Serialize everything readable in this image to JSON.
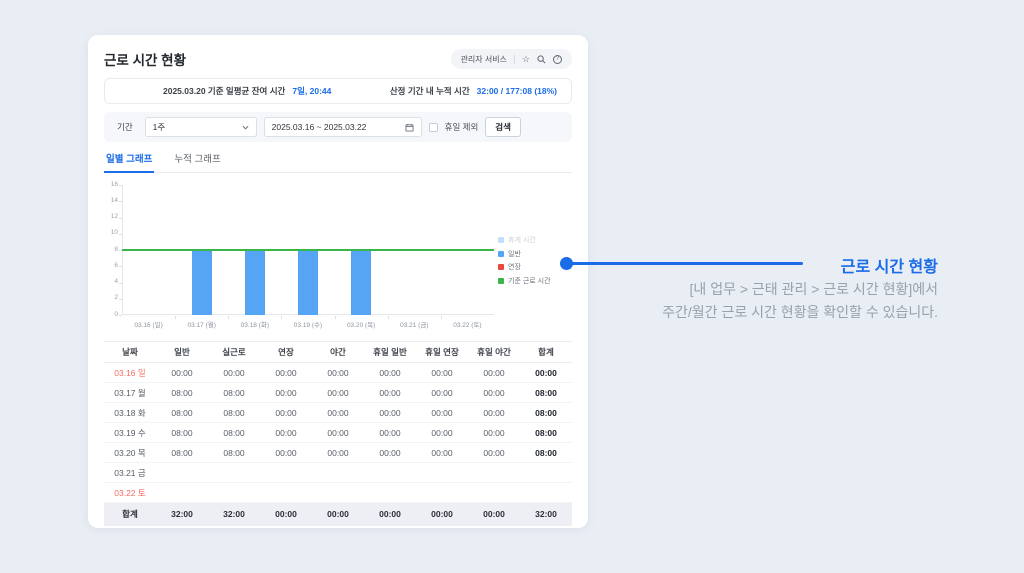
{
  "header": {
    "title": "근로 시간 현황",
    "admin_service_label": "관리자 서비스",
    "star_icon": "☆",
    "help_icon": "?"
  },
  "summary": {
    "left_label": "2025.03.20 기준 일평균 잔여 시간",
    "left_value": "7일, 20:44",
    "right_label": "산정 기간 내 누적 시간",
    "right_value": "32:00 / 177:08 (18%)"
  },
  "filter": {
    "period_label": "기간",
    "period_value": "1주",
    "date_range": "2025.03.16 ~ 2025.03.22",
    "holiday_checkbox_label": "휴일 제외",
    "holiday_checkbox_checked": false,
    "search_button_label": "검색"
  },
  "tabs": [
    {
      "label": "일별 그래프",
      "active": true
    },
    {
      "label": "누적 그래프",
      "active": false
    }
  ],
  "chart_data": {
    "type": "bar",
    "categories": [
      "03.16 (일)",
      "03.17 (월)",
      "03.18 (화)",
      "03.19 (수)",
      "03.20 (목)",
      "03.21 (금)",
      "03.22 (토)"
    ],
    "series": [
      {
        "name": "일반",
        "color": "#55a5f4",
        "values": [
          0,
          8,
          8,
          8,
          8,
          0,
          0
        ]
      },
      {
        "name": "연장",
        "color": "#e9493d",
        "values": [
          0,
          0,
          0,
          0,
          0,
          0,
          0
        ]
      }
    ],
    "reference_line": {
      "name": "기준 근로 시간",
      "value": 8,
      "color": "#3ab54a"
    },
    "legend": [
      {
        "label": "휴게 시간",
        "color": "#55a5f4",
        "muted": true
      },
      {
        "label": "일반",
        "color": "#55a5f4",
        "muted": false
      },
      {
        "label": "연장",
        "color": "#e9493d",
        "muted": false
      },
      {
        "label": "기준 근로 시간",
        "color": "#3ab54a",
        "muted": false
      }
    ],
    "title": "",
    "xlabel": "",
    "ylabel": "",
    "ylim": [
      0,
      16
    ],
    "ytick_step": 2,
    "grid": false,
    "legend_position": "right"
  },
  "table": {
    "headers": [
      "날짜",
      "일반",
      "실근로",
      "연장",
      "야간",
      "휴일 일반",
      "휴일 연장",
      "휴일 야간",
      "합계"
    ],
    "rows": [
      {
        "date": "03.16 일",
        "holiday": true,
        "values": [
          "00:00",
          "00:00",
          "00:00",
          "00:00",
          "00:00",
          "00:00",
          "00:00"
        ],
        "total": "00:00"
      },
      {
        "date": "03.17 월",
        "holiday": false,
        "values": [
          "08:00",
          "08:00",
          "00:00",
          "00:00",
          "00:00",
          "00:00",
          "00:00"
        ],
        "total": "08:00"
      },
      {
        "date": "03.18 화",
        "holiday": false,
        "values": [
          "08:00",
          "08:00",
          "00:00",
          "00:00",
          "00:00",
          "00:00",
          "00:00"
        ],
        "total": "08:00"
      },
      {
        "date": "03.19 수",
        "holiday": false,
        "values": [
          "08:00",
          "08:00",
          "00:00",
          "00:00",
          "00:00",
          "00:00",
          "00:00"
        ],
        "total": "08:00"
      },
      {
        "date": "03.20 목",
        "holiday": false,
        "values": [
          "08:00",
          "08:00",
          "00:00",
          "00:00",
          "00:00",
          "00:00",
          "00:00"
        ],
        "total": "08:00"
      },
      {
        "date": "03.21 금",
        "holiday": false,
        "values": [
          "",
          "",
          "",
          "",
          "",
          "",
          ""
        ],
        "total": ""
      },
      {
        "date": "03.22 토",
        "holiday": true,
        "values": [
          "",
          "",
          "",
          "",
          "",
          "",
          ""
        ],
        "total": ""
      }
    ],
    "footer": {
      "label": "합계",
      "values": [
        "32:00",
        "32:00",
        "00:00",
        "00:00",
        "00:00",
        "00:00",
        "00:00"
      ],
      "total": "32:00"
    }
  },
  "annotation": {
    "title": "근로 시간 현황",
    "line1": "[내 업무 > 근태 관리 > 근로 시간 현황]에서",
    "line2": "주간/월간 근로 시간 현황을 확인할 수 있습니다.",
    "accent_color": "#1b6ce8"
  }
}
